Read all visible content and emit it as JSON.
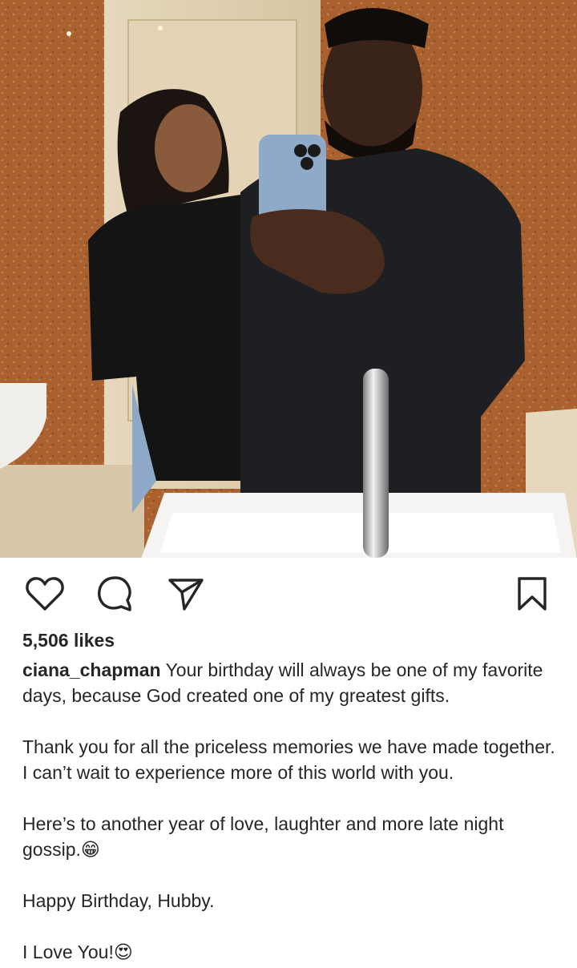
{
  "post": {
    "image_alt": "Couple taking a mirror selfie in a bathroom",
    "actions": {
      "like_icon": "heart-icon",
      "comment_icon": "comment-icon",
      "share_icon": "paper-plane-icon",
      "save_icon": "bookmark-icon"
    },
    "likes_text": "5,506 likes",
    "username": "ciana_chapman",
    "caption_first": " Your birthday will always be one of my favorite days, because God created one of my greatest gifts.",
    "caption_para2": "Thank you for all the priceless memories we have made together. I can’t wait to experience more of this world with you.",
    "caption_para3": "Here’s to another year of love, laughter and more late night gossip.😁",
    "caption_para4": "Happy Birthday, Hubby.",
    "caption_para5": "I Love You!😍"
  },
  "colors": {
    "text": "#262626",
    "wall": "#a8612f",
    "background": "#ffffff"
  }
}
